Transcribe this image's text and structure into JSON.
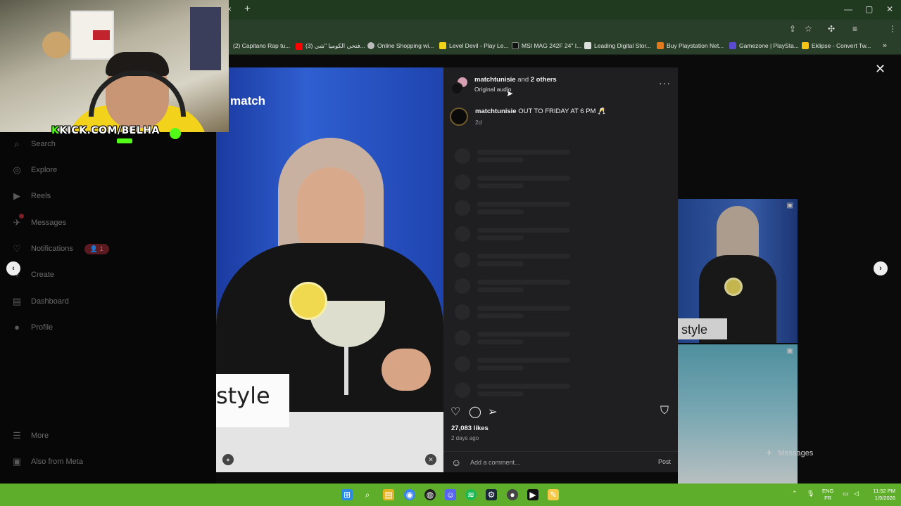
{
  "browser": {
    "tab_close_glyph": "×",
    "new_tab_glyph": "+",
    "bookmarks": [
      {
        "label": "(2) Capitano Rap tu...",
        "color": "#333333"
      },
      {
        "label": "(3) فتحي الكوميا \"شي...",
        "color": "#ff0000"
      },
      {
        "label": "Online Shopping wi...",
        "color": "#bbbbbb"
      },
      {
        "label": "Level Devil - Play Le...",
        "color": "#f2d31b"
      },
      {
        "label": "MSI MAG 242F 24\" I...",
        "color": "#111111"
      },
      {
        "label": "Leading Digital Stor...",
        "color": "#dddddd"
      },
      {
        "label": "Buy Playstation Net...",
        "color": "#e07a1f"
      },
      {
        "label": "Gamezone | PlaySta...",
        "color": "#5a4bd1"
      },
      {
        "label": "Eklipse - Convert Tw...",
        "color": "#f5c518"
      }
    ],
    "bookmarks_more": "»"
  },
  "stream": {
    "kick_prefix": "K",
    "kick_label": "KICK.COM/BELHA"
  },
  "sidebar": {
    "items": [
      {
        "label": "Search",
        "icon": "⌕"
      },
      {
        "label": "Explore",
        "icon": "◎"
      },
      {
        "label": "Reels",
        "icon": "▶"
      },
      {
        "label": "Messages",
        "icon": "✈"
      },
      {
        "label": "Notifications",
        "icon": "♡"
      },
      {
        "label": "Create",
        "icon": "+"
      },
      {
        "label": "Dashboard",
        "icon": "▤"
      },
      {
        "label": "Profile",
        "icon": "●"
      },
      {
        "label": "More",
        "icon": "☰"
      },
      {
        "label": "Also from Meta",
        "icon": "▣"
      }
    ],
    "notifications_badge": "1"
  },
  "modal": {
    "close_glyph": "✕",
    "prev_glyph": "‹",
    "next_glyph": "›"
  },
  "post": {
    "media_brand": "match",
    "card_text": "style",
    "header": {
      "username": "matchtunisie",
      "and_text": "and",
      "others": "2 others",
      "audio": "Original audio"
    },
    "caption": {
      "username": "matchtunisie",
      "text": "OUT TO FRIDAY AT 6 PM",
      "emoji": "🥂",
      "time": "2d"
    },
    "likes": "27,083 likes",
    "posted": "2 days ago",
    "comment_placeholder": "Add a comment...",
    "post_button": "Post"
  },
  "background_grid": {
    "thumb_text": "style",
    "floating_messages": "Messages"
  },
  "taskbar": {
    "lang_top": "ENG",
    "lang_bottom": "FR",
    "time": "11:52 PM",
    "date": "1/9/2026"
  }
}
